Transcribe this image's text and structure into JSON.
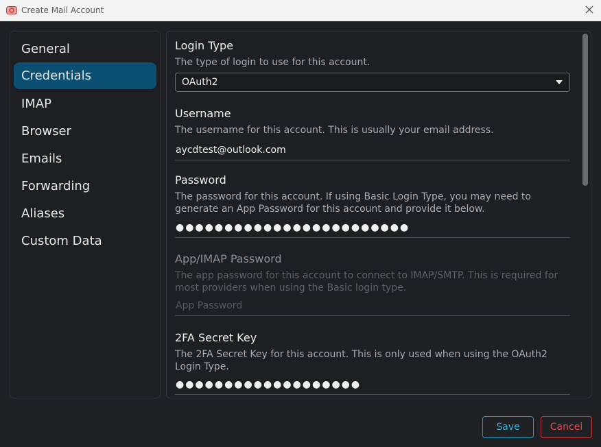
{
  "window": {
    "title": "Create Mail Account",
    "accent_color": "#0b4f72"
  },
  "sidebar": {
    "items": [
      {
        "label": "General",
        "active": false
      },
      {
        "label": "Credentials",
        "active": true
      },
      {
        "label": "IMAP",
        "active": false
      },
      {
        "label": "Browser",
        "active": false
      },
      {
        "label": "Emails",
        "active": false
      },
      {
        "label": "Forwarding",
        "active": false
      },
      {
        "label": "Aliases",
        "active": false
      },
      {
        "label": "Custom Data",
        "active": false
      }
    ]
  },
  "form": {
    "login_type": {
      "label": "Login Type",
      "description": "The type of login to use for this account.",
      "value": "OAuth2"
    },
    "username": {
      "label": "Username",
      "description": "The username for this account. This is usually your email address.",
      "value": "aycdtest@outlook.com"
    },
    "password": {
      "label": "Password",
      "description": "The password for this account. If using Basic Login Type, you may need to generate an App Password for this account and provide it below.",
      "value": "●●●●●●●●●●●●●●●●●●●●●●●●"
    },
    "app_password": {
      "label": "App/IMAP Password",
      "description": "The app password for this account to connect to IMAP/SMTP. This is required for most providers when using the Basic login type.",
      "placeholder": "App Password",
      "disabled": true
    },
    "twofa_key": {
      "label": "2FA Secret Key",
      "description": "The 2FA Secret Key for this account. This is only used when using the OAuth2 Login Type.",
      "value": "●●●●●●●●●●●●●●●●●●●"
    }
  },
  "buttons": {
    "save_label": "Save",
    "cancel_label": "Cancel"
  },
  "icons": {
    "app": "app-logo-icon",
    "close": "close-icon",
    "dropdown": "chevron-down-icon"
  }
}
